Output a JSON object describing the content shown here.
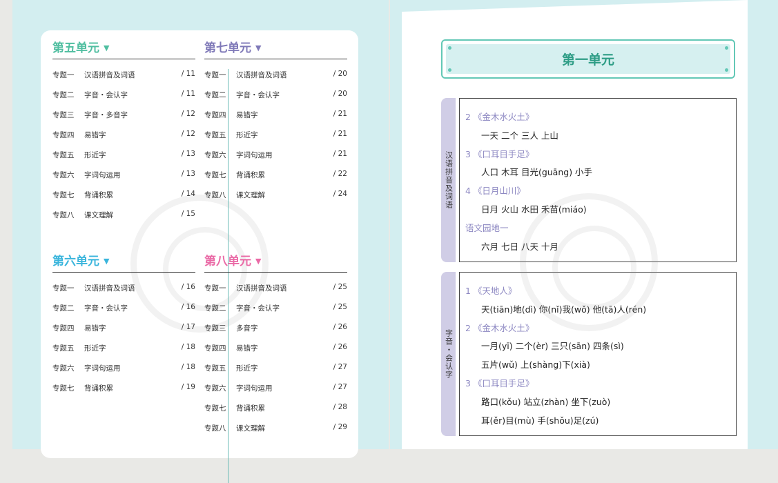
{
  "left_page": {
    "sections": [
      {
        "title": "第五单元",
        "color": "#4fbea0",
        "items": [
          {
            "num": "专题一",
            "name": "汉语拼音及词语",
            "page": "/ 11"
          },
          {
            "num": "专题二",
            "name": "字音・会认字",
            "page": "/ 11"
          },
          {
            "num": "专题三",
            "name": "字音・多音字",
            "page": "/ 12"
          },
          {
            "num": "专题四",
            "name": "易错字",
            "page": "/ 12"
          },
          {
            "num": "专题五",
            "name": "形近字",
            "page": "/ 13"
          },
          {
            "num": "专题六",
            "name": "字词句运用",
            "page": "/ 13"
          },
          {
            "num": "专题七",
            "name": "背诵积累",
            "page": "/ 14"
          },
          {
            "num": "专题八",
            "name": "课文理解",
            "page": "/ 15"
          }
        ]
      },
      {
        "title": "第七单元",
        "color": "#7f79b8",
        "items": [
          {
            "num": "专题一",
            "name": "汉语拼音及词语",
            "page": "/ 20"
          },
          {
            "num": "专题二",
            "name": "字音・会认字",
            "page": "/ 20"
          },
          {
            "num": "专题四",
            "name": "易错字",
            "page": "/ 21"
          },
          {
            "num": "专题五",
            "name": "形近字",
            "page": "/ 21"
          },
          {
            "num": "专题六",
            "name": "字词句运用",
            "page": "/ 21"
          },
          {
            "num": "专题七",
            "name": "背诵积累",
            "page": "/ 22"
          },
          {
            "num": "专题八",
            "name": "课文理解",
            "page": "/ 24"
          }
        ]
      },
      {
        "title": "第六单元",
        "color": "#3ab5dc",
        "items": [
          {
            "num": "专题一",
            "name": "汉语拼音及词语",
            "page": "/ 16"
          },
          {
            "num": "专题二",
            "name": "字音・会认字",
            "page": "/ 16"
          },
          {
            "num": "专题四",
            "name": "易错字",
            "page": "/ 17"
          },
          {
            "num": "专题五",
            "name": "形近字",
            "page": "/ 18"
          },
          {
            "num": "专题六",
            "name": "字词句运用",
            "page": "/ 18"
          },
          {
            "num": "专题七",
            "name": "背诵积累",
            "page": "/ 19"
          }
        ]
      },
      {
        "title": "第八单元",
        "color": "#ea6aa6",
        "items": [
          {
            "num": "专题一",
            "name": "汉语拼音及词语",
            "page": "/ 25"
          },
          {
            "num": "专题二",
            "name": "字音・会认字",
            "page": "/ 25"
          },
          {
            "num": "专题三",
            "name": "多音字",
            "page": "/ 26"
          },
          {
            "num": "专题四",
            "name": "易错字",
            "page": "/ 26"
          },
          {
            "num": "专题五",
            "name": "形近字",
            "page": "/ 27"
          },
          {
            "num": "专题六",
            "name": "字词句运用",
            "page": "/ 27"
          },
          {
            "num": "专题七",
            "name": "背诵积累",
            "page": "/ 28"
          },
          {
            "num": "专题八",
            "name": "课文理解",
            "page": "/ 29"
          }
        ]
      }
    ]
  },
  "right_page": {
    "unit_title": "第一单元",
    "blocks": [
      {
        "tab": "汉语拼音及词语",
        "lines": [
          {
            "type": "heading",
            "text": "2 《金木水火土》"
          },
          {
            "type": "words",
            "text": "一天   二个   三人   上山"
          },
          {
            "type": "heading",
            "text": "3 《口耳目手足》"
          },
          {
            "type": "words",
            "text": "人口   木耳   目光(guāng)   小手"
          },
          {
            "type": "heading",
            "text": "4 《日月山川》"
          },
          {
            "type": "words",
            "text": "日月   火山   水田   禾苗(miáo)"
          },
          {
            "type": "heading",
            "text": "语文园地一"
          },
          {
            "type": "words",
            "text": "六月   七日   八天   十月"
          }
        ]
      },
      {
        "tab": "字音・会认字",
        "lines": [
          {
            "type": "heading",
            "text": "1 《天地人》"
          },
          {
            "type": "words",
            "text": "天(tiān)地(dì)      你(nǐ)我(wǒ)      他(tā)人(rén)"
          },
          {
            "type": "heading",
            "text": "2 《金木水火土》"
          },
          {
            "type": "words",
            "text": "一月(yī)     二个(èr)     三只(sān)     四条(sì)"
          },
          {
            "type": "words",
            "text": "五片(wǔ)     上(shàng)下(xià)"
          },
          {
            "type": "heading",
            "text": "3 《口耳目手足》"
          },
          {
            "type": "words",
            "text": "路口(kǒu)            站立(zhàn)            坐下(zuò)"
          },
          {
            "type": "words",
            "text": "耳(ěr)目(mù)             手(shǒu)足(zú)"
          }
        ]
      }
    ]
  }
}
